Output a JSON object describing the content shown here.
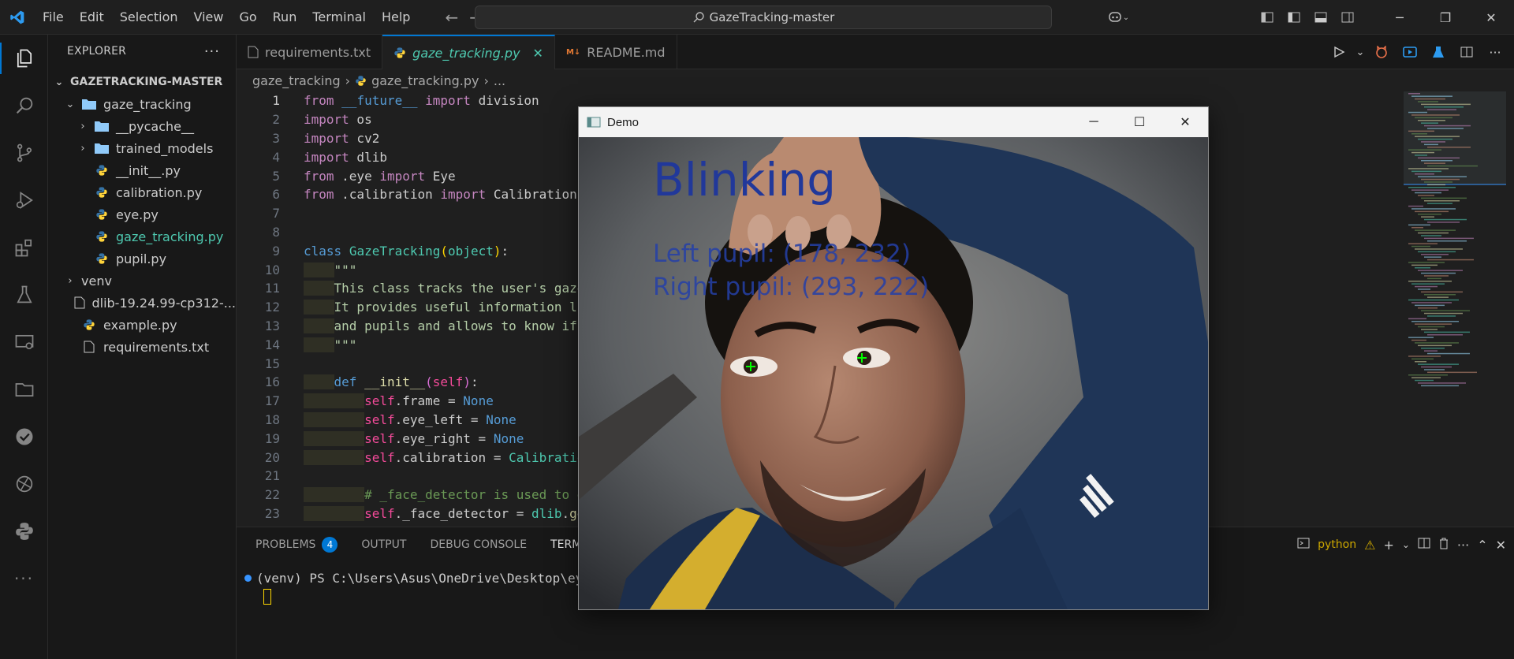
{
  "titlebar": {
    "menu": [
      "File",
      "Edit",
      "Selection",
      "View",
      "Go",
      "Run",
      "Terminal",
      "Help"
    ],
    "search_text": "GazeTracking-master"
  },
  "explorer": {
    "header": "EXPLORER",
    "root": "GAZETRACKING-MASTER",
    "items": [
      {
        "label": "gaze_tracking",
        "kind": "folder-open",
        "depth": 1
      },
      {
        "label": "__pycache__",
        "kind": "folder",
        "depth": 2
      },
      {
        "label": "trained_models",
        "kind": "folder",
        "depth": 2
      },
      {
        "label": "__init__.py",
        "kind": "py",
        "depth": 2
      },
      {
        "label": "calibration.py",
        "kind": "py",
        "depth": 2
      },
      {
        "label": "eye.py",
        "kind": "py",
        "depth": 2
      },
      {
        "label": "gaze_tracking.py",
        "kind": "py",
        "depth": 2,
        "selected": true
      },
      {
        "label": "pupil.py",
        "kind": "py",
        "depth": 2
      },
      {
        "label": "venv",
        "kind": "folder",
        "depth": 1
      },
      {
        "label": "dlib-19.24.99-cp312-...",
        "kind": "file",
        "depth": 1
      },
      {
        "label": "example.py",
        "kind": "py",
        "depth": 1
      },
      {
        "label": "requirements.txt",
        "kind": "file",
        "depth": 1
      }
    ]
  },
  "tabs": [
    {
      "label": "requirements.txt",
      "icon": "file-icon"
    },
    {
      "label": "gaze_tracking.py",
      "icon": "python-icon",
      "active": true
    },
    {
      "label": "README.md",
      "icon": "markdown-icon"
    }
  ],
  "breadcrumb": {
    "folder": "gaze_tracking",
    "file": "gaze_tracking.py",
    "more": "..."
  },
  "code": {
    "line_numbers": [
      "1",
      "2",
      "3",
      "4",
      "5",
      "6",
      "7",
      "8",
      "9",
      "10",
      "11",
      "12",
      "13",
      "14",
      "15",
      "16",
      "17",
      "18",
      "19",
      "20",
      "21",
      "22",
      "23"
    ]
  },
  "panel": {
    "tabs": [
      "PROBLEMS",
      "OUTPUT",
      "DEBUG CONSOLE",
      "TERMINAL"
    ],
    "problems_count": "4",
    "terminal_label": "python",
    "prompt": "(venv) PS C:\\Users\\Asus\\OneDrive\\Desktop\\eyeba"
  },
  "demo": {
    "title": "Demo",
    "status": "Blinking",
    "left_pupil": "Left pupil:  (178, 232)",
    "right_pupil": "Right pupil: (293, 222)"
  }
}
